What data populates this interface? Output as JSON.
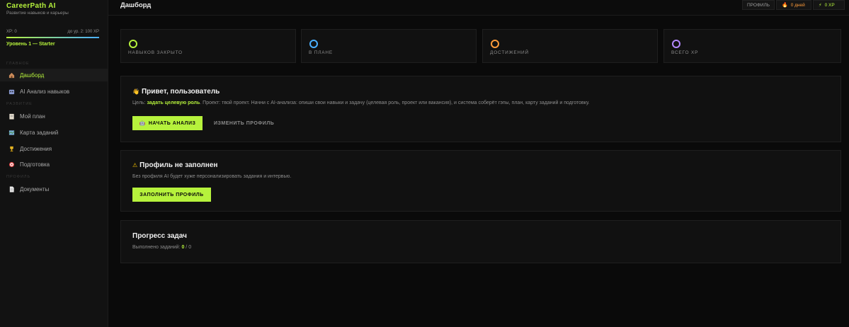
{
  "sidebar": {
    "brand": "CareerPath AI",
    "subtitle": "Развитие навыков и карьеры",
    "xp_left": "XP: 0",
    "xp_right": "до ур. 2: 100 XP",
    "xp_progress": 1.0,
    "level": "Уровень 1 — Starter",
    "sections": [
      "ГЛАВНОЕ",
      "РАЗВИТИЕ",
      "ПРОФИЛЬ"
    ],
    "items": [
      {
        "label": "Дашборд",
        "icon": "house-icon"
      },
      {
        "label": "AI Анализ навыков",
        "icon": "robot-icon"
      },
      {
        "label": "Мой план",
        "icon": "clipboard-icon"
      },
      {
        "label": "Карта заданий",
        "icon": "map-icon"
      },
      {
        "label": "Достижения",
        "icon": "trophy-icon"
      },
      {
        "label": "Подготовка",
        "icon": "target-icon"
      },
      {
        "label": "Документы",
        "icon": "document-icon"
      }
    ]
  },
  "header": {
    "title": "Дашборд",
    "profile_label": "ПРОФИЛЬ",
    "days_label": "0 дней",
    "xp_label": "0 XP"
  },
  "stats": [
    {
      "label": "НАВЫКОВ ЗАКРЫТО",
      "color": "#b6f23c"
    },
    {
      "label": "В ПЛАНЕ",
      "color": "#4ab0ff"
    },
    {
      "label": "ДОСТИЖЕНИЙ",
      "color": "#ff9c3a"
    },
    {
      "label": "ВСЕГО XP",
      "color": "#b388ff"
    }
  ],
  "greeting": {
    "title": "Привет, пользователь",
    "goal_prefix": "Цель:",
    "goal_link": "задать целевую роль",
    "project_text": ". Проект: твой проект. Начни с AI-анализа: опиши свои навыки и задачу (целевая роль, проект или вакансия), и система соберёт гэпы, план, карту заданий и подготовку.",
    "start_button": "НАЧАТЬ АНАЛИЗ",
    "edit_button": "ИЗМЕНИТЬ ПРОФИЛЬ"
  },
  "profile_warning": {
    "title": "Профиль не заполнен",
    "text": "Без профиля AI будет хуже персонализировать задания и интервью.",
    "button": "ЗАПОЛНИТЬ ПРОФИЛЬ"
  },
  "progress": {
    "title": "Прогресс задач",
    "text": "Выполнено заданий:",
    "done": "0",
    "sep": " / ",
    "total": "0"
  }
}
